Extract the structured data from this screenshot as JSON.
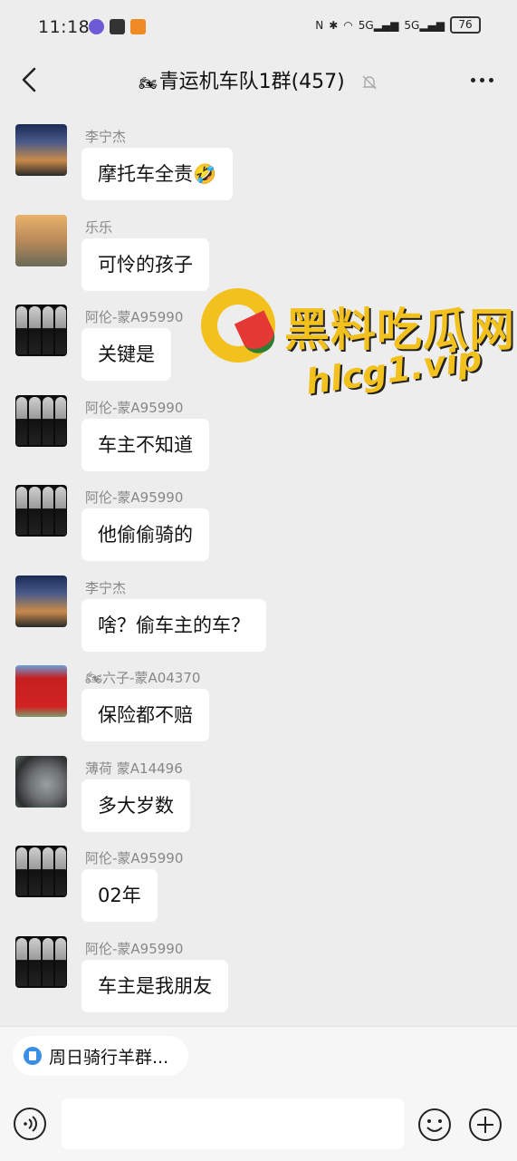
{
  "status_bar": {
    "time": "11:18",
    "battery": "76",
    "signal_1": "5G",
    "signal_2": "5G"
  },
  "header": {
    "title_emoji": "🏍",
    "title": "青运机车队1群(457)"
  },
  "messages": [
    {
      "sender": "李宁杰",
      "text": "摩托车全责🤣",
      "avatar": "sunset"
    },
    {
      "sender": "乐乐",
      "text": "可怜的孩子",
      "avatar": "road"
    },
    {
      "sender": "阿伦-蒙A95990",
      "text": "关键是",
      "avatar": "faces"
    },
    {
      "sender": "阿伦-蒙A95990",
      "text": "车主不知道",
      "avatar": "faces"
    },
    {
      "sender": "阿伦-蒙A95990",
      "text": "他偷偷骑的",
      "avatar": "faces"
    },
    {
      "sender": "李宁杰",
      "text": "啥？偷车主的车？",
      "avatar": "sunset"
    },
    {
      "sender": "🏍六子-蒙A04370",
      "text": "保险都不赔",
      "avatar": "flag"
    },
    {
      "sender": "薄荷 蒙A14496",
      "text": "多大岁数",
      "avatar": "mirror"
    },
    {
      "sender": "阿伦-蒙A95990",
      "text": "02年",
      "avatar": "faces"
    },
    {
      "sender": "阿伦-蒙A95990",
      "text": "车主是我朋友",
      "avatar": "faces"
    }
  ],
  "watermark": {
    "name": "黑料吃瓜网",
    "url": "hlcg1.vip"
  },
  "bottom": {
    "chip_label": "周日骑行羊群...",
    "input_value": ""
  },
  "colors": {
    "background": "#ededed",
    "bubble": "#ffffff",
    "sender_text": "#888888",
    "watermark": "#f3c11d"
  }
}
